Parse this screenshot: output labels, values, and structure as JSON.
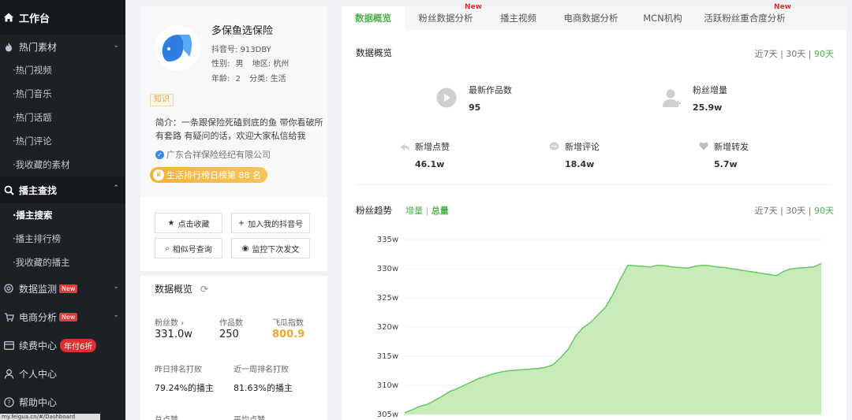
{
  "sidebar": {
    "workbench": "工作台",
    "groups": [
      {
        "label": "热门素材",
        "items": [
          "热门视频",
          "热门音乐",
          "热门话题",
          "热门评论",
          "我收藏的素材"
        ]
      },
      {
        "label": "播主查找",
        "items": [
          "播主搜索",
          "播主排行榜",
          "我收藏的播主"
        ]
      },
      {
        "label": "数据监测",
        "badge": "New"
      },
      {
        "label": "电商分析",
        "badge": "New"
      },
      {
        "label": "续费中心",
        "badge": "年付6折"
      },
      {
        "label": "个人中心"
      },
      {
        "label": "帮助中心"
      }
    ],
    "url_tip": "my.feigua.cn/#/Dashboard"
  },
  "profile": {
    "name": "多保鱼选保险",
    "douyin_id_label": "抖音号:",
    "douyin_id": "913DBY",
    "gender_label": "性别:",
    "gender": "男",
    "region_label": "地区:",
    "region": "杭州",
    "age_label": "年龄:",
    "age": "2",
    "category_label": "分类:",
    "category": "生活",
    "tag": "知识",
    "intro": "简介：一条跟保险死磕到底的鱼 带你看破所有套路 有疑问的话，欢迎大家私信给我",
    "company": "广东合祥保险经纪有限公司",
    "rank": "生活排行榜日榜第 88 名",
    "actions": {
      "favorite": "点击收藏",
      "add_mine": "加入我的抖音号",
      "similar": "相似号查询",
      "monitor": "监控下次发文"
    },
    "overview": {
      "title": "数据概览",
      "fans_label": "粉丝数",
      "fans": "331.0w",
      "works_label": "作品数",
      "works": "250",
      "index_label": "飞瓜指数",
      "index": "800.9",
      "yesterday_label": "昨日排名打败",
      "yesterday": "79.24%的播主",
      "week_label": "近一周排名打败",
      "week": "81.63%的播主",
      "total_likes_label": "总点赞",
      "avg_likes_label": "平均点赞"
    }
  },
  "main": {
    "tabs": [
      {
        "label": "数据概览",
        "new": ""
      },
      {
        "label": "粉丝数据分析",
        "new": "New"
      },
      {
        "label": "播主视频",
        "new": ""
      },
      {
        "label": "电商数据分析",
        "new": ""
      },
      {
        "label": "MCN机构",
        "new": ""
      },
      {
        "label": "活跃粉丝重合度分析",
        "new": "New"
      }
    ],
    "overview": {
      "title": "数据概览",
      "range": [
        "近7天",
        "30天",
        "90天"
      ],
      "new_works_label": "最新作品数",
      "new_works": "95",
      "fans_gain_label": "粉丝增量",
      "fans_gain": "25.9w",
      "likes_label": "新增点赞",
      "likes": "46.1w",
      "comments_label": "新增评论",
      "comments": "18.4w",
      "shares_label": "新增转发",
      "shares": "5.7w"
    },
    "trend": {
      "title": "粉丝趋势",
      "toggle_a": "增量",
      "toggle_b": "总量",
      "range": [
        "近7天",
        "30天",
        "90天"
      ]
    }
  },
  "colors": {
    "accent": "#4bb34b",
    "sidebar_bg": "#1d2126",
    "area_fill": "#c8ebb9",
    "line": "#66c766"
  },
  "chart_data": {
    "type": "area",
    "title": "",
    "xlabel": "",
    "ylabel": "",
    "ylim": [
      305,
      335
    ],
    "yticks": [
      "305w",
      "310w",
      "315w",
      "320w",
      "325w",
      "330w",
      "335w"
    ],
    "y": [
      305.3,
      305.8,
      306.4,
      306.7,
      307.4,
      308.1,
      308.9,
      309.4,
      310.0,
      310.6,
      311.2,
      311.6,
      312.0,
      312.3,
      312.5,
      312.6,
      312.7,
      312.8,
      312.9,
      313.1,
      313.6,
      314.8,
      316.2,
      318.5,
      319.9,
      320.8,
      322.1,
      323.4,
      325.6,
      328.2,
      330.6,
      330.5,
      330.4,
      330.3,
      330.6,
      330.5,
      330.3,
      330.2,
      330.1,
      330.4,
      330.6,
      330.5,
      330.3,
      330.2,
      330.0,
      329.8,
      329.6,
      329.4,
      329.2,
      329.0,
      328.8,
      329.6,
      330.0,
      330.1,
      330.2,
      330.3,
      330.9
    ]
  }
}
